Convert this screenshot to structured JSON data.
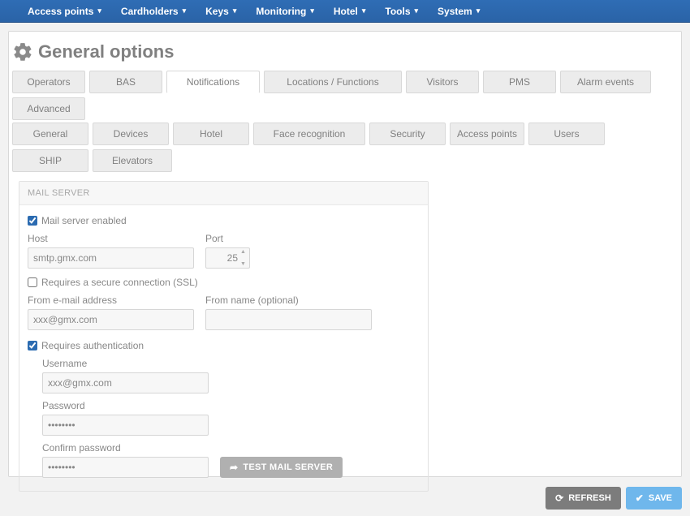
{
  "nav": {
    "items": [
      "Access points",
      "Cardholders",
      "Keys",
      "Monitoring",
      "Hotel",
      "Tools",
      "System"
    ]
  },
  "page": {
    "title": "General options"
  },
  "tabs_row1": [
    "Operators",
    "BAS",
    "Notifications",
    "Locations / Functions",
    "Visitors",
    "PMS",
    "Alarm events",
    "Advanced"
  ],
  "tabs_row2": [
    "General",
    "Devices",
    "Hotel",
    "Face recognition",
    "Security",
    "Access points",
    "Users",
    "SHIP",
    "Elevators"
  ],
  "mail": {
    "section_title": "MAIL SERVER",
    "enabled_label": "Mail server enabled",
    "enabled": true,
    "host_label": "Host",
    "host": "smtp.gmx.com",
    "port_label": "Port",
    "port": "25",
    "ssl_label": "Requires a secure connection (SSL)",
    "ssl": false,
    "from_email_label": "From e-mail address",
    "from_email": "xxx@gmx.com",
    "from_name_label": "From name (optional)",
    "from_name": "",
    "auth_label": "Requires authentication",
    "auth": true,
    "username_label": "Username",
    "username": "xxx@gmx.com",
    "password_label": "Password",
    "password": "••••••••",
    "confirm_label": "Confirm password",
    "confirm": "••••••••",
    "test_label": "TEST MAIL SERVER"
  },
  "footer": {
    "refresh": "REFRESH",
    "save": "SAVE"
  }
}
